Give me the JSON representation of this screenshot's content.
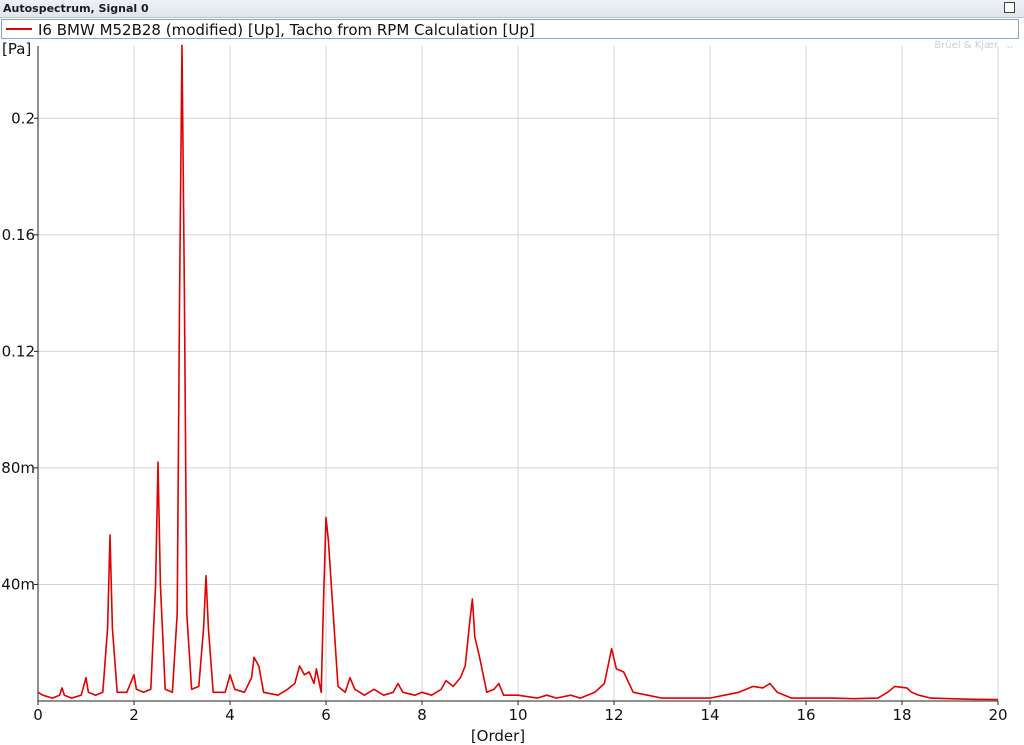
{
  "window": {
    "title": "Autospectrum, Signal 0"
  },
  "legend": {
    "label": "I6 BMW M52B28 (modified) [Up], Tacho from RPM Calculation [Up]",
    "color": "#e00000"
  },
  "watermark": "Brüel & Kjær",
  "chart_data": {
    "type": "line",
    "title": "",
    "xlabel": "[Order]",
    "ylabel": "[Pa]",
    "xlim": [
      0,
      20
    ],
    "ylim": [
      0,
      0.2248
    ],
    "grid": true,
    "x_ticks": [
      {
        "value": 0,
        "label": "0"
      },
      {
        "value": 2,
        "label": "2"
      },
      {
        "value": 4,
        "label": "4"
      },
      {
        "value": 6,
        "label": "6"
      },
      {
        "value": 8,
        "label": "8"
      },
      {
        "value": 10,
        "label": "10"
      },
      {
        "value": 12,
        "label": "12"
      },
      {
        "value": 14,
        "label": "14"
      },
      {
        "value": 16,
        "label": "16"
      },
      {
        "value": 18,
        "label": "18"
      },
      {
        "value": 20,
        "label": "20"
      }
    ],
    "y_ticks": [
      {
        "value": 0.04,
        "label": "40m"
      },
      {
        "value": 0.08,
        "label": "80m"
      },
      {
        "value": 0.12,
        "label": "0.12"
      },
      {
        "value": 0.16,
        "label": "0.16"
      },
      {
        "value": 0.2,
        "label": "0.2"
      }
    ],
    "series": [
      {
        "color": "#e00000",
        "points": [
          [
            0,
            0.003
          ],
          [
            0.1,
            0.002
          ],
          [
            0.3,
            0.001
          ],
          [
            0.45,
            0.002
          ],
          [
            0.5,
            0.0045
          ],
          [
            0.55,
            0.002
          ],
          [
            0.7,
            0.001
          ],
          [
            0.9,
            0.002
          ],
          [
            1.0,
            0.008
          ],
          [
            1.05,
            0.003
          ],
          [
            1.2,
            0.002
          ],
          [
            1.35,
            0.003
          ],
          [
            1.45,
            0.025
          ],
          [
            1.5,
            0.057
          ],
          [
            1.55,
            0.025
          ],
          [
            1.65,
            0.003
          ],
          [
            1.85,
            0.003
          ],
          [
            2.0,
            0.009
          ],
          [
            2.05,
            0.004
          ],
          [
            2.2,
            0.003
          ],
          [
            2.35,
            0.004
          ],
          [
            2.45,
            0.04
          ],
          [
            2.5,
            0.082
          ],
          [
            2.55,
            0.04
          ],
          [
            2.65,
            0.004
          ],
          [
            2.8,
            0.003
          ],
          [
            2.9,
            0.03
          ],
          [
            2.95,
            0.14
          ],
          [
            3.0,
            0.225
          ],
          [
            3.05,
            0.14
          ],
          [
            3.1,
            0.03
          ],
          [
            3.2,
            0.004
          ],
          [
            3.35,
            0.005
          ],
          [
            3.45,
            0.025
          ],
          [
            3.5,
            0.043
          ],
          [
            3.55,
            0.025
          ],
          [
            3.65,
            0.003
          ],
          [
            3.9,
            0.003
          ],
          [
            4.0,
            0.009
          ],
          [
            4.1,
            0.004
          ],
          [
            4.3,
            0.003
          ],
          [
            4.45,
            0.008
          ],
          [
            4.5,
            0.015
          ],
          [
            4.6,
            0.012
          ],
          [
            4.7,
            0.003
          ],
          [
            5.0,
            0.002
          ],
          [
            5.2,
            0.004
          ],
          [
            5.35,
            0.006
          ],
          [
            5.45,
            0.012
          ],
          [
            5.55,
            0.009
          ],
          [
            5.65,
            0.01
          ],
          [
            5.75,
            0.006
          ],
          [
            5.8,
            0.011
          ],
          [
            5.9,
            0.003
          ],
          [
            5.95,
            0.035
          ],
          [
            6.0,
            0.063
          ],
          [
            6.05,
            0.055
          ],
          [
            6.15,
            0.03
          ],
          [
            6.25,
            0.005
          ],
          [
            6.4,
            0.003
          ],
          [
            6.5,
            0.008
          ],
          [
            6.6,
            0.004
          ],
          [
            6.8,
            0.002
          ],
          [
            7.0,
            0.004
          ],
          [
            7.2,
            0.002
          ],
          [
            7.4,
            0.003
          ],
          [
            7.5,
            0.006
          ],
          [
            7.6,
            0.003
          ],
          [
            7.85,
            0.002
          ],
          [
            8.0,
            0.003
          ],
          [
            8.2,
            0.002
          ],
          [
            8.4,
            0.004
          ],
          [
            8.5,
            0.007
          ],
          [
            8.65,
            0.005
          ],
          [
            8.8,
            0.008
          ],
          [
            8.9,
            0.012
          ],
          [
            9.0,
            0.028
          ],
          [
            9.05,
            0.035
          ],
          [
            9.1,
            0.022
          ],
          [
            9.2,
            0.015
          ],
          [
            9.35,
            0.003
          ],
          [
            9.5,
            0.004
          ],
          [
            9.6,
            0.006
          ],
          [
            9.7,
            0.002
          ],
          [
            10.0,
            0.002
          ],
          [
            10.4,
            0.001
          ],
          [
            10.6,
            0.002
          ],
          [
            10.8,
            0.001
          ],
          [
            11.1,
            0.002
          ],
          [
            11.3,
            0.001
          ],
          [
            11.6,
            0.003
          ],
          [
            11.8,
            0.006
          ],
          [
            11.95,
            0.018
          ],
          [
            12.05,
            0.011
          ],
          [
            12.2,
            0.01
          ],
          [
            12.4,
            0.003
          ],
          [
            12.7,
            0.002
          ],
          [
            13.0,
            0.001
          ],
          [
            13.5,
            0.001
          ],
          [
            14.0,
            0.001
          ],
          [
            14.3,
            0.002
          ],
          [
            14.6,
            0.003
          ],
          [
            14.9,
            0.005
          ],
          [
            15.1,
            0.0045
          ],
          [
            15.25,
            0.006
          ],
          [
            15.4,
            0.003
          ],
          [
            15.7,
            0.001
          ],
          [
            16.5,
            0.001
          ],
          [
            17.0,
            0.0008
          ],
          [
            17.5,
            0.001
          ],
          [
            17.7,
            0.003
          ],
          [
            17.85,
            0.005
          ],
          [
            18.1,
            0.0045
          ],
          [
            18.2,
            0.003
          ],
          [
            18.35,
            0.002
          ],
          [
            18.6,
            0.001
          ],
          [
            19.0,
            0.0008
          ],
          [
            19.5,
            0.0006
          ],
          [
            20.0,
            0.0005
          ]
        ]
      }
    ]
  }
}
